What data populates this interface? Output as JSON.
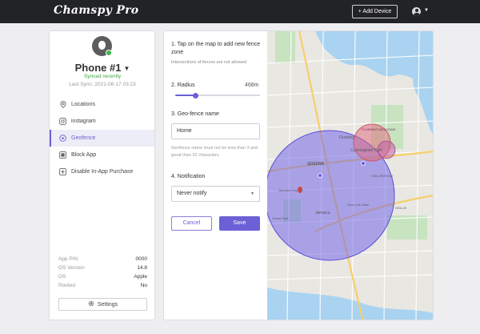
{
  "header": {
    "logo": "Chamspy Pro",
    "add_device": "+ Add Device",
    "avatar_icon": "user-avatar-icon",
    "colors": {
      "bar": "#222326"
    }
  },
  "sidebar": {
    "device_name": "Phone #1",
    "sync_status": "Synced recently",
    "last_sync": "Last Sync: 2021-08-17 03:23",
    "nav": [
      {
        "label": "Locations",
        "icon": "location-pin-icon",
        "active": false
      },
      {
        "label": "instagram",
        "icon": "instagram-icon",
        "active": false
      },
      {
        "label": "Geofence",
        "icon": "geofence-icon",
        "active": true
      },
      {
        "label": "Block App",
        "icon": "block-app-icon",
        "active": false
      },
      {
        "label": "Disable In-App Purchase",
        "icon": "disable-purchase-icon",
        "active": false
      }
    ],
    "info": [
      {
        "key": "App PIN",
        "value": "0000"
      },
      {
        "key": "OS Version",
        "value": "14.8"
      },
      {
        "key": "OS",
        "value": "Apple"
      },
      {
        "key": "Rooted",
        "value": "No"
      }
    ],
    "settings_label": "Settings",
    "accent": "#6b60d6"
  },
  "geofence": {
    "step1": "1. Tap on the map to add new fence zone",
    "step1_note": "Intersections of fences are not allowed",
    "radius_label": "2. Radius",
    "radius_value": "468m",
    "radius_fraction": 0.24,
    "step3": "3. Geo-fence name",
    "name_value": "Home",
    "name_hint": "Geofence name must not be less than 3 and great than 32 characters",
    "step4": "4. Notification",
    "notify_value": "Never notify",
    "cancel_label": "Cancel",
    "save_label": "Save"
  },
  "map": {
    "labels": [
      "QUEENS",
      "Flushing",
      "Jamaica",
      "Cunningham Park",
      "FLUSHING MEADOWS",
      "New York State",
      "Jamaica Hospital",
      "Forest Park",
      "HOLLIS",
      "HOLLISWOOD"
    ],
    "fence_colors": {
      "large": "#6a5be8",
      "small": "#e2687a"
    }
  }
}
